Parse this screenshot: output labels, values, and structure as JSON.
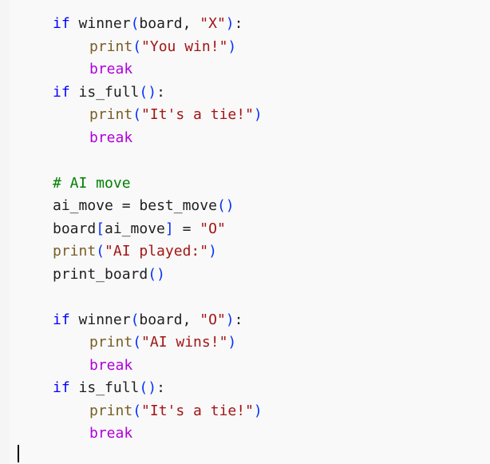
{
  "colors": {
    "keyword": "#0000ff",
    "control": "#af00db",
    "function": "#795e26",
    "string": "#a31515",
    "comment": "#008000",
    "bracket": "#0431fa",
    "text": "#1f1f1f",
    "background": "#f9f9f9"
  },
  "code": {
    "kw_if": "if",
    "kw_break": "break",
    "winner": "winner",
    "board": "board",
    "comma": ",",
    "colon": ":",
    "lparen": "(",
    "rparen": ")",
    "print": "print",
    "is_full": "is_full",
    "best_move": "best_move",
    "print_board": "print_board",
    "ai_move": "ai_move",
    "assign": "=",
    "lbracket": "[",
    "rbracket": "]",
    "str_x": "\"X\"",
    "str_o": "\"O\"",
    "str_you_win": "\"You win!\"",
    "str_tie": "\"It's a tie!\"",
    "str_ai_played": "\"AI played:\"",
    "str_ai_wins": "\"AI wins!\"",
    "comment_ai_move": "# AI move"
  }
}
